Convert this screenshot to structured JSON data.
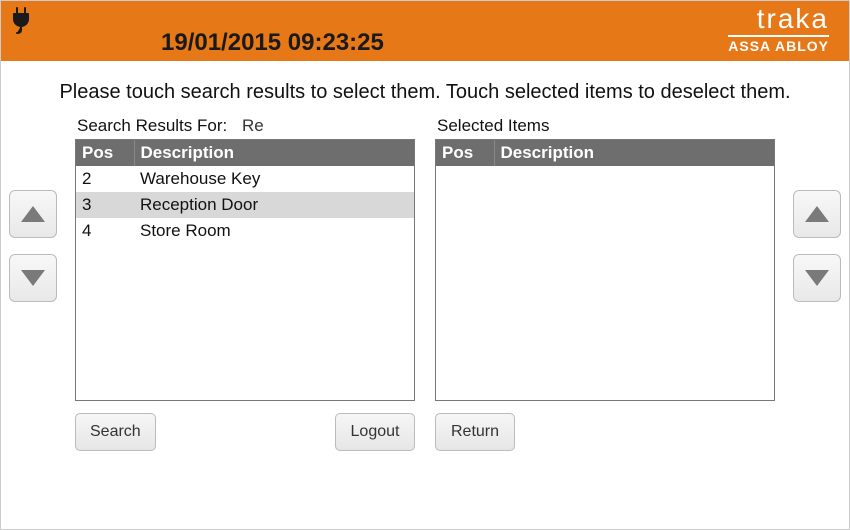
{
  "header": {
    "datetime": "19/01/2015 09:23:25",
    "brand_primary": "traka",
    "brand_secondary": "ASSA ABLOY"
  },
  "instruction": "Please touch search results to select them. Touch selected items to deselect them.",
  "results": {
    "label": "Search Results For:",
    "query": "Re",
    "columns": {
      "pos": "Pos",
      "description": "Description"
    },
    "rows": [
      {
        "pos": "2",
        "description": "Warehouse Key",
        "selected": false
      },
      {
        "pos": "3",
        "description": "Reception Door",
        "selected": true
      },
      {
        "pos": "4",
        "description": "Store Room",
        "selected": false
      }
    ]
  },
  "selected": {
    "label": "Selected Items",
    "columns": {
      "pos": "Pos",
      "description": "Description"
    },
    "rows": []
  },
  "buttons": {
    "search": "Search",
    "logout": "Logout",
    "return": "Return"
  },
  "colors": {
    "accent": "#e67817",
    "header_row": "#6e6e6e"
  }
}
